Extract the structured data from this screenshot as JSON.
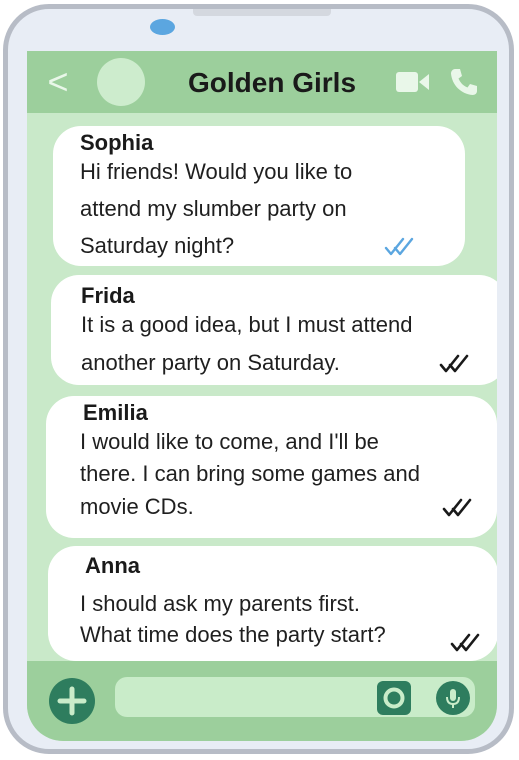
{
  "header": {
    "back_glyph": "<",
    "title": "Golden Girls",
    "icons": [
      "video-camera-icon",
      "phone-icon"
    ]
  },
  "messages": [
    {
      "sender": "Sophia",
      "lines": [
        "Hi friends! Would you like to",
        "attend my slumber party on",
        "Saturday night?"
      ],
      "status_icon": "double-check-icon",
      "status_color": "#5ba6e0"
    },
    {
      "sender": "Frida",
      "lines": [
        "It is a good idea, but I must attend",
        "another party on Saturday."
      ],
      "status_icon": "double-check-icon",
      "status_color": "#1a1a1a"
    },
    {
      "sender": "Emilia",
      "lines": [
        "I would like to come, and I'll be",
        "there. I can bring some games and",
        "movie CDs."
      ],
      "status_icon": "double-check-icon",
      "status_color": "#1a1a1a"
    },
    {
      "sender": "Anna",
      "lines": [
        "I should ask my parents first.",
        "What time does the party start?"
      ],
      "status_icon": "double-check-icon",
      "status_color": "#1a1a1a"
    }
  ],
  "composer": {
    "placeholder": "",
    "icons": [
      "plus-icon",
      "camera-icon",
      "microphone-icon"
    ]
  },
  "colors": {
    "header_bar": "#9ccf9c",
    "chat_background": "#c9e9c9",
    "accent": "#2e7d5e",
    "bubble": "#ffffff"
  }
}
